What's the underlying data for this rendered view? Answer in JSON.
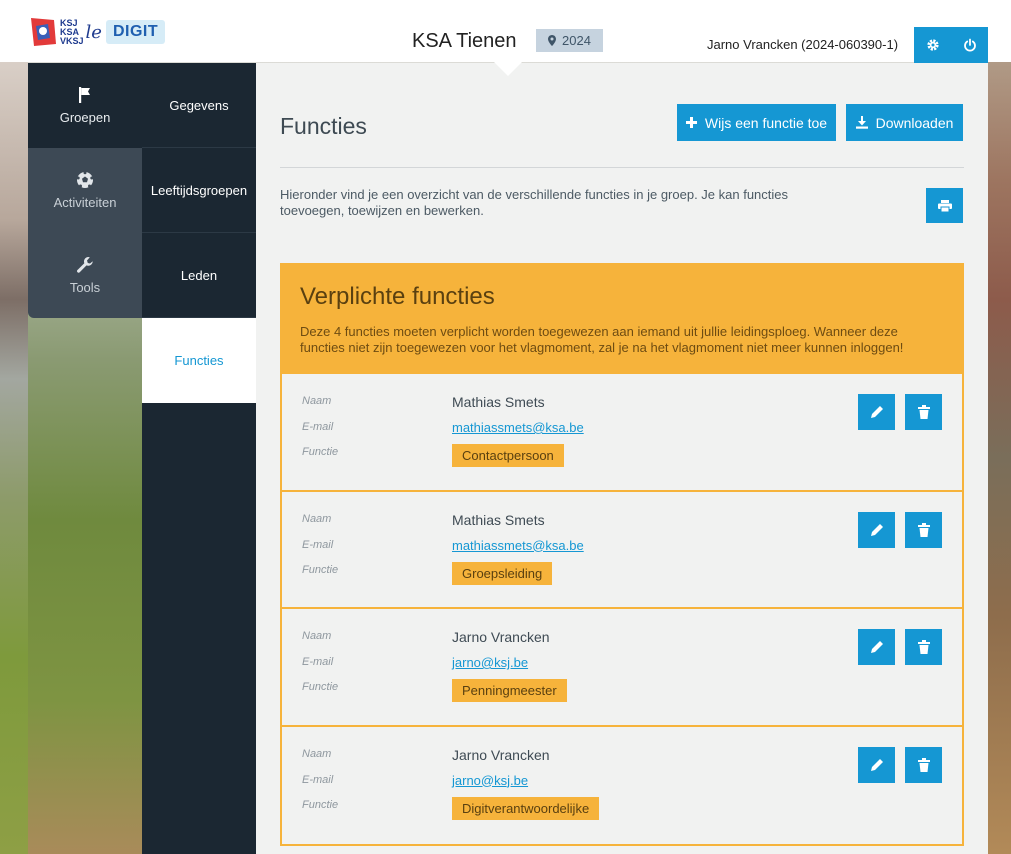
{
  "header": {
    "logo_lines": [
      "KSJ",
      "KSA",
      "VKSJ"
    ],
    "logo_le": "le",
    "logo_digit": "DIGIT",
    "group_title": "KSA Tienen",
    "year": "2024",
    "user": "Jarno Vrancken (2024-060390-1)"
  },
  "nav_primary": [
    {
      "label": "Groepen",
      "icon": "flag-icon",
      "active": true
    },
    {
      "label": "Activiteiten",
      "icon": "soccer-ball-icon",
      "active": false
    },
    {
      "label": "Tools",
      "icon": "wrench-icon",
      "active": false
    }
  ],
  "nav_secondary": [
    {
      "label": "Gegevens",
      "active": false
    },
    {
      "label": "Leeftijdsgroepen",
      "active": false
    },
    {
      "label": "Leden",
      "active": false
    },
    {
      "label": "Functies",
      "active": true
    }
  ],
  "main": {
    "title": "Functies",
    "assign_button": "Wijs een functie toe",
    "download_button": "Downloaden",
    "intro": "Hieronder vind je een overzicht van de verschillende functies in je groep. Je kan functies toevoegen, toewijzen en bewerken."
  },
  "panel": {
    "title": "Verplichte functies",
    "description": "Deze 4 functies moeten verplicht worden toegewezen aan iemand uit jullie leidingsploeg. Wanneer deze functies niet zijn toegewezen voor het vlagmoment, zal je na het vlagmoment niet meer kunnen inloggen!",
    "field_labels": {
      "name": "Naam",
      "email": "E-mail",
      "function": "Functie"
    },
    "rows": [
      {
        "name": "Mathias Smets",
        "email": "mathiassmets@ksa.be",
        "function": "Contactpersoon"
      },
      {
        "name": "Mathias Smets",
        "email": "mathiassmets@ksa.be",
        "function": "Groepsleiding"
      },
      {
        "name": "Jarno Vrancken",
        "email": "jarno@ksj.be",
        "function": "Penningmeester"
      },
      {
        "name": "Jarno Vrancken",
        "email": "jarno@ksj.be",
        "function": "Digitverantwoordelijke"
      }
    ]
  },
  "colors": {
    "accent": "#1597d3",
    "warning": "#f6b33b",
    "sidebar_dark": "#1b2732"
  }
}
